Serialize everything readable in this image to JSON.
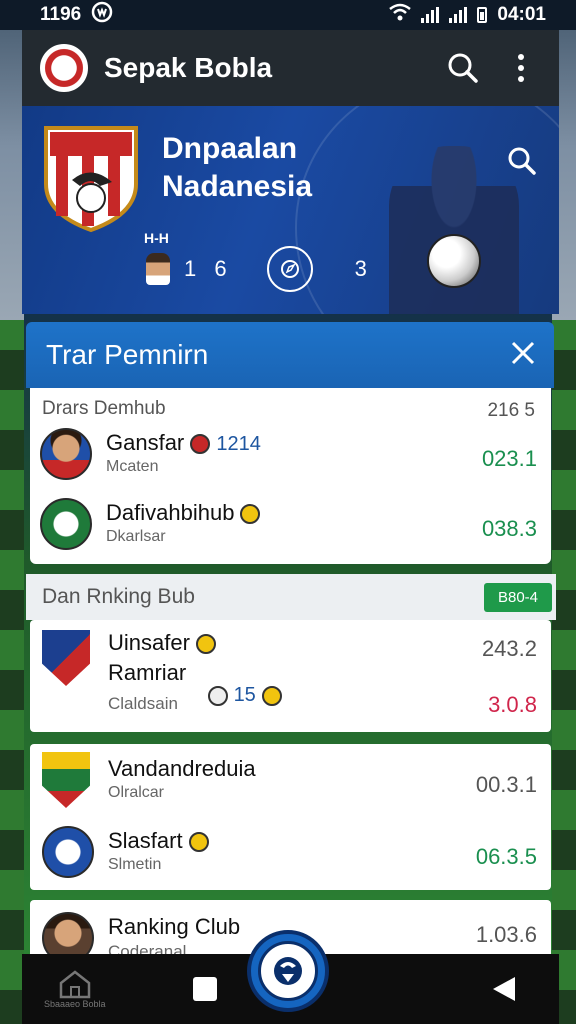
{
  "status_bar": {
    "time_left": "1196",
    "time_right": "04:01"
  },
  "app_bar": {
    "title": "Sepak Bobla"
  },
  "hero": {
    "title": "Dnpaalan Nadanesia",
    "small_text": "H-H",
    "stat_left": "1 6",
    "stat_right": "3"
  },
  "card": {
    "header_title": "Trar Pemnirn",
    "section_label": "Drars Demhub",
    "section_value": "216 5",
    "rows": [
      {
        "name": "Gansfar",
        "tag": "1214",
        "sub": "Mcaten",
        "score": "023.1"
      },
      {
        "name": "Dafivahbihub",
        "sub": "Dkarlsar",
        "score": "038.3"
      }
    ]
  },
  "ranking": {
    "label": "Dan Rnking Bub",
    "badge": "B80-4",
    "card2": {
      "name_line1": "Uinsafer",
      "name_line2": "Ramriar",
      "sub": "Claldsain",
      "mini": "15",
      "score_top": "243.2",
      "score_bottom": "3.0.8"
    },
    "card3": [
      {
        "name": "Vandandreduia",
        "sub": "Olralcar",
        "score": "00.3.1"
      },
      {
        "name": "Slasfart",
        "sub": "Slmetin",
        "score": "06.3.5"
      }
    ],
    "card4": {
      "name": "Ranking Club",
      "sub": "Coderanal",
      "score": "1.03.6"
    }
  },
  "nav": {
    "home_label": "Sbaaaeo Bobla"
  },
  "colors": {
    "accent": "#1e73c9",
    "positive": "#1a8f4f",
    "negative": "#d0254b",
    "badge": "#1f9a4a"
  },
  "icons": [
    "search-icon",
    "more-vert-icon",
    "close-icon",
    "home-icon",
    "square-icon",
    "back-icon",
    "wifi-icon",
    "signal-icon",
    "battery-icon"
  ]
}
